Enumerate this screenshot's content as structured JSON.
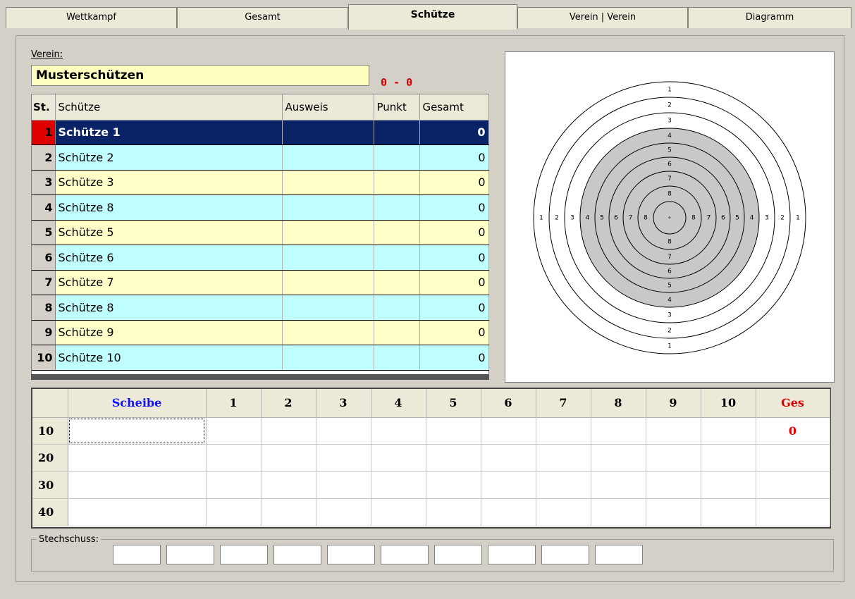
{
  "tabs": [
    {
      "label": "Wettkampf",
      "active": false
    },
    {
      "label": "Gesamt",
      "active": false
    },
    {
      "label": "Schütze",
      "active": true
    },
    {
      "label": "Verein | Verein",
      "active": false
    },
    {
      "label": "Diagramm",
      "active": false
    }
  ],
  "verein": {
    "label": "Verein:",
    "value": "Musterschützen",
    "score": "0 - 0"
  },
  "shooters_table": {
    "columns": [
      "St.",
      "Schütze",
      "Ausweis",
      "Punkt",
      "Gesamt"
    ],
    "rows": [
      {
        "st": "1",
        "name": "Schütze 1",
        "ausweis": "",
        "punkt": "",
        "gesamt": "0"
      },
      {
        "st": "2",
        "name": "Schütze 2",
        "ausweis": "",
        "punkt": "",
        "gesamt": "0"
      },
      {
        "st": "3",
        "name": "Schütze 3",
        "ausweis": "",
        "punkt": "",
        "gesamt": "0"
      },
      {
        "st": "4",
        "name": "Schütze 8",
        "ausweis": "",
        "punkt": "",
        "gesamt": "0"
      },
      {
        "st": "5",
        "name": "Schütze 5",
        "ausweis": "",
        "punkt": "",
        "gesamt": "0"
      },
      {
        "st": "6",
        "name": "Schütze 6",
        "ausweis": "",
        "punkt": "",
        "gesamt": "0"
      },
      {
        "st": "7",
        "name": "Schütze 7",
        "ausweis": "",
        "punkt": "",
        "gesamt": "0"
      },
      {
        "st": "8",
        "name": "Schütze 8",
        "ausweis": "",
        "punkt": "",
        "gesamt": "0"
      },
      {
        "st": "9",
        "name": "Schütze 9",
        "ausweis": "",
        "punkt": "",
        "gesamt": "0"
      },
      {
        "st": "10",
        "name": "Schütze 10",
        "ausweis": "",
        "punkt": "",
        "gesamt": "0"
      }
    ]
  },
  "target": {
    "ring_labels_outer_to_inner": [
      "1",
      "2",
      "3",
      "4",
      "5",
      "6",
      "7",
      "8"
    ],
    "center_mark": "∘",
    "colors": {
      "black_area": "#c8c8c8",
      "ring_line": "#000000",
      "background": "#ffffff"
    }
  },
  "score_grid": {
    "header": [
      "",
      "Scheibe",
      "1",
      "2",
      "3",
      "4",
      "5",
      "6",
      "7",
      "8",
      "9",
      "10",
      "Ges"
    ],
    "rows": [
      {
        "label": "10",
        "ges": "0"
      },
      {
        "label": "20",
        "ges": ""
      },
      {
        "label": "30",
        "ges": ""
      },
      {
        "label": "40",
        "ges": ""
      }
    ]
  },
  "stechschuss": {
    "label": "Stechschuss:",
    "fields": [
      "",
      "",
      "",
      "",
      "",
      "",
      "",
      "",
      "",
      ""
    ]
  },
  "colors": {
    "selected_row": "#0a2366",
    "row_yellow": "#ffffc8",
    "row_cyan": "#c0ffff",
    "score_red": "#e00000",
    "header_blue": "#1010ff"
  }
}
